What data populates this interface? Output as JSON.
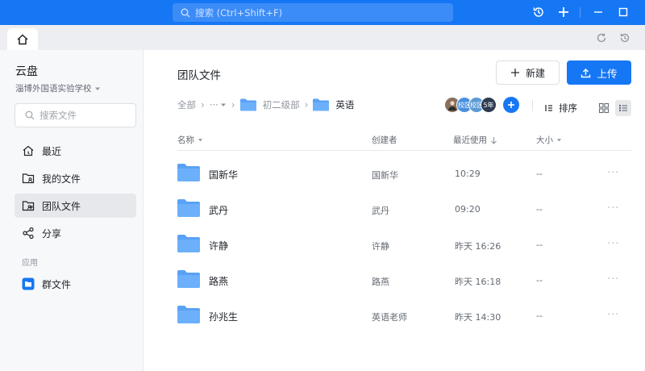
{
  "topbar": {
    "search_placeholder": "搜索 (Ctrl+Shift+F)"
  },
  "sidebar": {
    "title": "云盘",
    "org_name": "淄博外国语实验学校",
    "search_placeholder": "搜索文件",
    "items": [
      {
        "label": "最近",
        "icon": "clock-house-icon"
      },
      {
        "label": "我的文件",
        "icon": "user-folder-icon"
      },
      {
        "label": "团队文件",
        "icon": "team-folder-icon",
        "active": true
      },
      {
        "label": "分享",
        "icon": "share-icon"
      }
    ],
    "section_label": "应用",
    "apps": [
      {
        "label": "群文件",
        "icon": "group-files-icon"
      }
    ]
  },
  "main": {
    "page_title": "团队文件",
    "new_button": "新建",
    "upload_button": "上传",
    "breadcrumb": {
      "root": "全部",
      "ellipsis": "···",
      "parent": "初二级部",
      "current": "英语"
    },
    "members": [
      {
        "label": "",
        "color": "#8a6f5c"
      },
      {
        "label": "校区",
        "color": "#4a90e2"
      },
      {
        "label": "校区",
        "color": "#5b9bd5"
      },
      {
        "label": "5年",
        "color": "#2f3b52"
      }
    ],
    "sort_label": "排序",
    "columns": {
      "name": "名称",
      "creator": "创建者",
      "recent": "最近使用",
      "size": "大小"
    },
    "rows": [
      {
        "name": "国新华",
        "creator": "国新华",
        "time": "10:29",
        "size": "--"
      },
      {
        "name": "武丹",
        "creator": "武丹",
        "time": "09:20",
        "size": "--"
      },
      {
        "name": "许静",
        "creator": "许静",
        "time": "昨天 16:26",
        "size": "--"
      },
      {
        "name": "路燕",
        "creator": "路燕",
        "time": "昨天 16:18",
        "size": "--"
      },
      {
        "name": "孙兆生",
        "creator": "英语老师",
        "time": "昨天 14:30",
        "size": "--"
      }
    ],
    "more_glyph": "···"
  },
  "colors": {
    "accent": "#1677f5",
    "folder": "#5aa2f5"
  }
}
